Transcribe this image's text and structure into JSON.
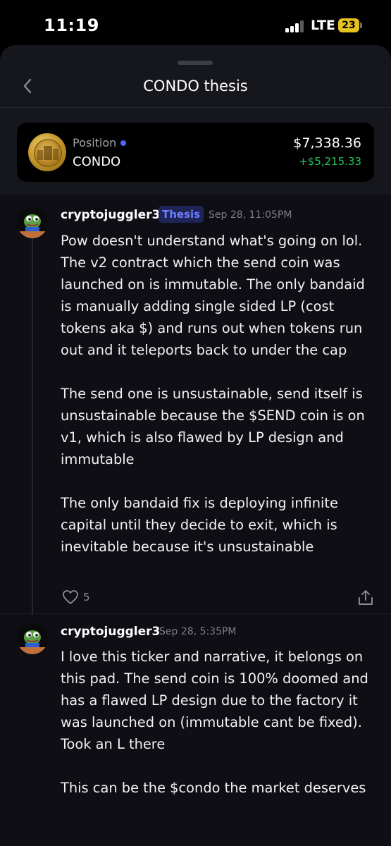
{
  "status": {
    "time": "11:19",
    "network": "LTE",
    "battery": "23"
  },
  "header": {
    "title": "CONDO thesis"
  },
  "position": {
    "label": "Position",
    "ticker": "CONDO",
    "value": "$7,338.36",
    "gain": "+$5,215.33",
    "gain_color": "#22c55e"
  },
  "comments": [
    {
      "username": "cryptojuggler3",
      "badge": "Thesis",
      "date": "Sep 28, 11:05PM",
      "paragraphs": [
        "Pow doesn't understand what's going on lol. The v2 contract which the send coin was launched on is immutable. The only bandaid is manually adding single sided LP (cost tokens aka $) and runs out when tokens run out and it teleports back to under the cap",
        "The send one is unsustainable, send itself is unsustainable because the $SEND coin is on v1, which is also flawed by LP design and immutable",
        "The only bandaid fix is deploying infinite capital until they decide to exit, which is inevitable because it's unsustainable"
      ],
      "likes": "5"
    },
    {
      "username": "cryptojuggler3",
      "date": "Sep 28, 5:35PM",
      "paragraphs": [
        "I love this ticker and narrative, it belongs on this pad. The send coin is 100% doomed and has a flawed LP design due to the factory it was launched on (immutable cant be fixed). Took an L there",
        "This can be the $condo the market deserves"
      ]
    }
  ],
  "icons": {
    "back": "chevron-left-icon",
    "like": "heart-icon",
    "share": "share-icon",
    "signal": "signal-bars-icon",
    "battery": "battery-icon",
    "position_status": "blue-dot-icon",
    "coin": "condo-coin-logo",
    "avatar": "pepe-avatar"
  },
  "colors": {
    "accent": "#4f63ff",
    "badge_text": "#6d7dff",
    "gain": "#22c55e"
  }
}
